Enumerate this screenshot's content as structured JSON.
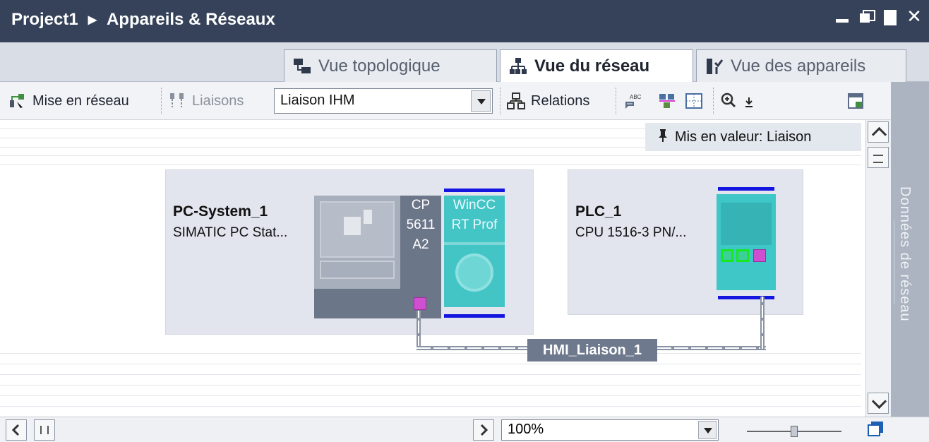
{
  "titlebar": {
    "project": "Project1",
    "separator": "▶",
    "section": "Appareils & Réseaux"
  },
  "tabs": [
    {
      "label": "Vue topologique",
      "active": false,
      "icon": "topology-icon"
    },
    {
      "label": "Vue du réseau",
      "active": true,
      "icon": "network-icon"
    },
    {
      "label": "Vue des appareils",
      "active": false,
      "icon": "devices-icon"
    }
  ],
  "toolbar": {
    "network_label": "Mise en réseau",
    "connections_label": "Liaisons",
    "connection_type": "Liaison IHM",
    "relations_label": "Relations"
  },
  "tooltip": {
    "pin": "🖈",
    "text": "Mis en valeur: Liaison"
  },
  "stations": {
    "pc": {
      "name": "PC-System_1",
      "type": "SIMATIC PC Stat...",
      "cp_lines": [
        "CP",
        "5611",
        "A2"
      ],
      "wincc_lines": [
        "WinCC",
        "RT Prof"
      ]
    },
    "plc": {
      "name": "PLC_1",
      "type": "CPU 1516-3 PN/..."
    }
  },
  "connection": {
    "label": "HMI_Liaison_1"
  },
  "sidepanel": {
    "label": "Données de réseau"
  },
  "bottombar": {
    "zoom": "100%"
  },
  "colors": {
    "titlebar": "#35425a",
    "accent_bar": "#1515e0",
    "port_magenta": "#cf4fd0",
    "module_cyan": "#43c4c5"
  }
}
